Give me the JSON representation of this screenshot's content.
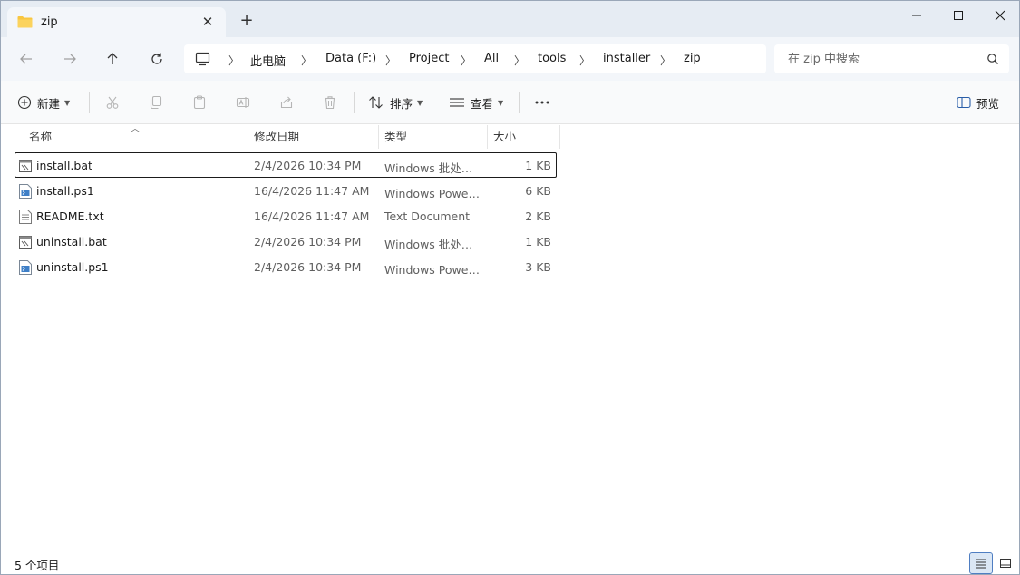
{
  "tab": {
    "title": "zip"
  },
  "breadcrumb": [
    "此电脑",
    "Data (F:)",
    "Project",
    "All",
    "tools",
    "installer",
    "zip"
  ],
  "search": {
    "placeholder": "在 zip 中搜索"
  },
  "toolbar": {
    "new_label": "新建",
    "sort_label": "排序",
    "view_label": "查看",
    "preview_label": "预览"
  },
  "columns": {
    "name": "名称",
    "date": "修改日期",
    "type": "类型",
    "size": "大小"
  },
  "files": [
    {
      "name": "install.bat",
      "date": "2/4/2026 10:34 PM",
      "type": "Windows 批处理文件",
      "size": "1 KB",
      "kind": "bat-icon"
    },
    {
      "name": "install.ps1",
      "date": "16/4/2026 11:47 AM",
      "type": "Windows PowerShell 脚本",
      "size": "6 KB",
      "kind": "ps1-icon"
    },
    {
      "name": "README.txt",
      "date": "16/4/2026 11:47 AM",
      "type": "Text Document",
      "size": "2 KB",
      "kind": "txt-icon"
    },
    {
      "name": "uninstall.bat",
      "date": "2/4/2026 10:34 PM",
      "type": "Windows 批处理文件",
      "size": "1 KB",
      "kind": "bat-icon"
    },
    {
      "name": "uninstall.ps1",
      "date": "2/4/2026 10:34 PM",
      "type": "Windows PowerShell 脚本",
      "size": "3 KB",
      "kind": "ps1-icon"
    }
  ],
  "status": {
    "count": "5 个项目"
  },
  "colors": {
    "titlebar": "#e6ecf3",
    "addressrow": "#f3f6fa",
    "accent": "#4f7ec2",
    "folder": "#f8c640"
  }
}
